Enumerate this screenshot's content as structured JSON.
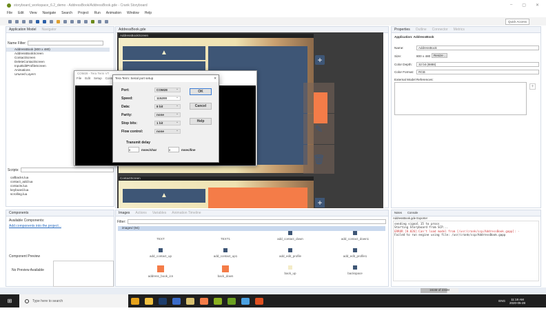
{
  "window": {
    "title": "storyboard_workspace_6.2_demo - AddressBook/AddressBook.gde - Crank Storyboard",
    "min": "–",
    "max": "▢",
    "close": "✕"
  },
  "menu": [
    "File",
    "Edit",
    "View",
    "Navigate",
    "Search",
    "Project",
    "Run",
    "Animation",
    "Window",
    "Help"
  ],
  "toolbar": {
    "quick_access": "Quick Access"
  },
  "app_model": {
    "tab": "Application Model",
    "tab2": "Navigator",
    "name_filter_label": "Name Filter:",
    "name_filter_value": "",
    "tree": [
      "AddressBook (800 x 480)",
      "AddressBookScreen",
      "ContactScreen",
      "DeleteContactScreen",
      "InputEditProfileScreen",
      "Animations",
      "Unused Layers"
    ],
    "scripts_label": "Scripts:",
    "scripts": [
      "callbacks.lua",
      "contact_add.lua",
      "contacts.lua",
      "keyboard.lua",
      "scrolling.lua"
    ]
  },
  "components": {
    "tab": "Components",
    "available": "Available Components:",
    "add_link": "Add components into the project...",
    "preview_label": "Component Preview",
    "no_preview": "No Preview Available"
  },
  "editor": {
    "tab": "AddressBook.gde",
    "screens": [
      "AddressBookScreen",
      "ContactScreen"
    ]
  },
  "teraterm": {
    "title": "COM28 - Tera Term VT",
    "menu": [
      "File",
      "Edit",
      "Setup",
      "Control"
    ],
    "dialog": {
      "title": "Tera Term: Serial port setup",
      "close": "✕",
      "fields": [
        {
          "label": "Port:",
          "value": "COM28"
        },
        {
          "label": "Speed:",
          "value": "115200"
        },
        {
          "label": "Data:",
          "value": "8 bit"
        },
        {
          "label": "Parity:",
          "value": "none"
        },
        {
          "label": "Stop bits:",
          "value": "1 bit"
        },
        {
          "label": "Flow control:",
          "value": "none"
        }
      ],
      "ok": "OK",
      "cancel": "Cancel",
      "help": "Help",
      "transmit_delay": "Transmit delay",
      "char_value": "0",
      "char_unit": "msec/char",
      "line_value": "0",
      "line_unit": "msec/line"
    }
  },
  "properties": {
    "tabs": [
      "Properties",
      "Outline",
      "Connector",
      "Metrics"
    ],
    "heading": "Application: AddressBook",
    "name_label": "Name:",
    "name_value": "AddressBook",
    "size_label": "Size:",
    "size_value": "800 x 480",
    "resize": "Resize ...",
    "depth_label": "Color Depth:",
    "depth_value": "32 bit (8888)",
    "format_label": "Color Format:",
    "format_value": "RGB",
    "ext_label": "External Model References:"
  },
  "images": {
    "tabs": [
      "Images",
      "Actions",
      "Variables",
      "Animation Timeline"
    ],
    "filter_label": "Filter:",
    "filter_value": "",
    "folder": "images/ (94)",
    "items": [
      "TEXT",
      "TEXT1",
      "add_contact_down",
      "add_contact_down1",
      "add_contact_up",
      "add_contact_up1",
      "add_edit_profile",
      "add_edit_profile1",
      "address_book_icn",
      "back_down",
      "back_up",
      "backspace"
    ]
  },
  "console": {
    "tabs": [
      "Notes",
      "Console"
    ],
    "title": "AddressBook.gde Exporter",
    "lines": [
      {
        "text": "sending signal 15 to procs",
        "error": false
      },
      {
        "text": "Starting Storyboard from SCP...",
        "error": false
      },
      {
        "text": "ERROR  [0.026]:Can't load model from [/usr/crank/scp/AddressBook.gapp]: -",
        "error": true
      },
      {
        "text": "Failed to run engine using file: /usr/crank/scp/AddressBook.gapp",
        "error": false
      }
    ]
  },
  "status": {
    "memory": "161M of 231M"
  },
  "taskbar": {
    "search_placeholder": "Type here to search",
    "time": "11:18 AM",
    "date": "2020-05-28",
    "lang": "ENG"
  },
  "colors": {
    "navy": "#3e5676",
    "orange": "#f47c48",
    "error": "#d04040",
    "link": "#2a6cc0"
  }
}
